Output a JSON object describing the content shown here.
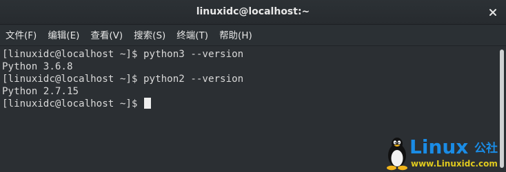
{
  "window": {
    "title": "linuxidc@localhost:~"
  },
  "menu": [
    {
      "label": "文件(F)"
    },
    {
      "label": "编辑(E)"
    },
    {
      "label": "查看(V)"
    },
    {
      "label": "搜索(S)"
    },
    {
      "label": "终端(T)"
    },
    {
      "label": "帮助(H)"
    }
  ],
  "terminal": {
    "lines": [
      "[linuxidc@localhost ~]$ python3 --version",
      "Python 3.6.8",
      "[linuxidc@localhost ~]$ python2 --version",
      "Python 2.7.15",
      "[linuxidc@localhost ~]$ "
    ]
  },
  "watermark": {
    "brand": "Linux",
    "brand_cn": "公社",
    "url": "www.Linuxidc.com"
  },
  "colors": {
    "background": "#2b2f33",
    "text": "#d9d9d9",
    "watermark_blue": "#1a8ce6",
    "watermark_yellow": "#e0ca1e"
  },
  "icons": {
    "close": "close-icon",
    "mascot": "tux-penguin-icon"
  }
}
